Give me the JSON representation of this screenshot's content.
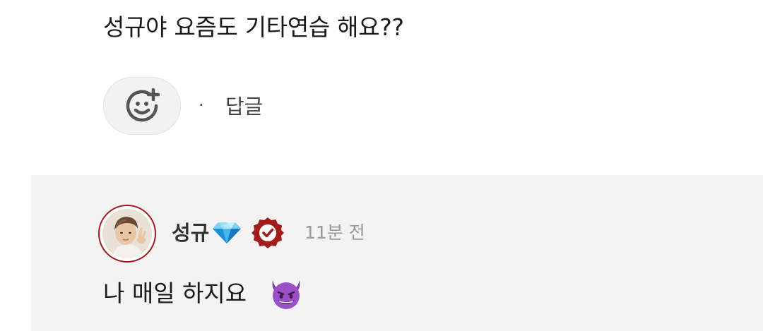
{
  "comment": {
    "text": "성규야 요즘도 기타연습 해요??",
    "reaction_icon": "add-reaction-smiley-icon",
    "separator": "·",
    "reply_label": "답글"
  },
  "reply": {
    "username": "성규",
    "name_badge_icon": "diamond-icon",
    "verified_icon": "verified-badge-icon",
    "timestamp": "11분 전",
    "text": "나 매일 하지요",
    "emoji_icon": "smiling-devil-icon"
  },
  "colors": {
    "background": "#ffffff",
    "reply_background": "#f3f3f3",
    "avatar_ring": "#a31c1c",
    "verified_badge": "#a31c1c",
    "gem": "#2fa8e8",
    "devil": "#9b4fc9",
    "text_primary": "#1a1a1a",
    "text_secondary": "#999999"
  }
}
